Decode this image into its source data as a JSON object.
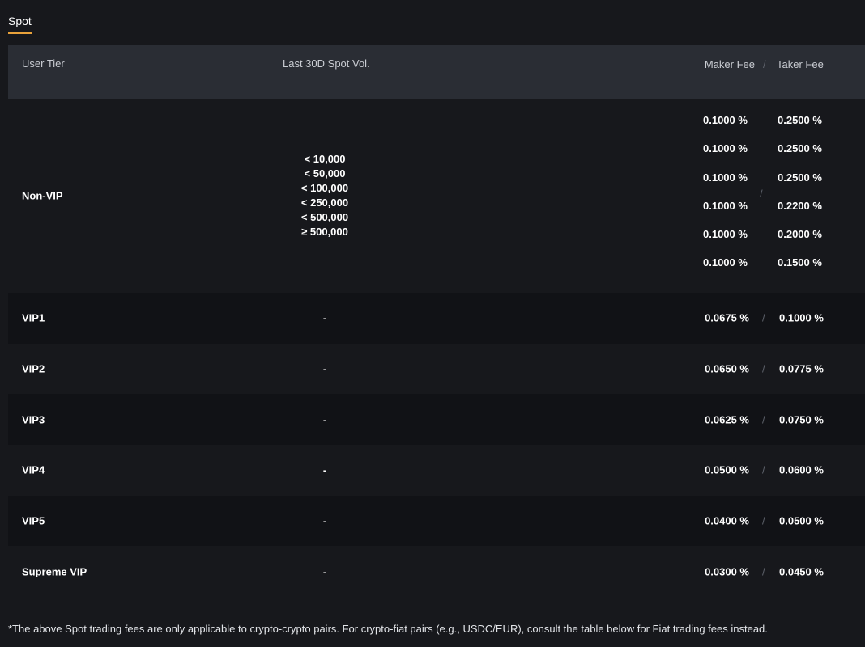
{
  "tab": {
    "label": "Spot"
  },
  "table": {
    "headers": {
      "tier": "User Tier",
      "volume": "Last 30D Spot Vol.",
      "maker": "Maker Fee",
      "separator": "/",
      "taker": "Taker Fee"
    },
    "non_vip": {
      "tier": "Non-VIP",
      "volumes": [
        "< 10,000",
        "< 50,000",
        "< 100,000",
        "< 250,000",
        "< 500,000",
        "≥ 500,000"
      ],
      "maker_fees": [
        "0.1000 %",
        "0.1000 %",
        "0.1000 %",
        "0.1000 %",
        "0.1000 %",
        "0.1000 %"
      ],
      "taker_fees": [
        "0.2500 %",
        "0.2500 %",
        "0.2500 %",
        "0.2200 %",
        "0.2000 %",
        "0.1500 %"
      ],
      "separator": "/"
    },
    "rows": [
      {
        "tier": "VIP1",
        "volume": "-",
        "maker": "0.0675 %",
        "taker": "0.1000 %"
      },
      {
        "tier": "VIP2",
        "volume": "-",
        "maker": "0.0650 %",
        "taker": "0.0775 %"
      },
      {
        "tier": "VIP3",
        "volume": "-",
        "maker": "0.0625 %",
        "taker": "0.0750 %"
      },
      {
        "tier": "VIP4",
        "volume": "-",
        "maker": "0.0500 %",
        "taker": "0.0600 %"
      },
      {
        "tier": "VIP5",
        "volume": "-",
        "maker": "0.0400 %",
        "taker": "0.0500 %"
      },
      {
        "tier": "Supreme VIP",
        "volume": "-",
        "maker": "0.0300 %",
        "taker": "0.0450 %"
      }
    ],
    "row_separator": "/"
  },
  "footnote": "*The above Spot trading fees are only applicable to crypto-crypto pairs. For crypto-fiat pairs (e.g., USDC/EUR), consult the table below for Fiat trading fees instead.",
  "colors": {
    "background": "#17181c",
    "header_bg": "#2a2d34",
    "row_dark": "#111216",
    "accent": "#e9a23b"
  }
}
